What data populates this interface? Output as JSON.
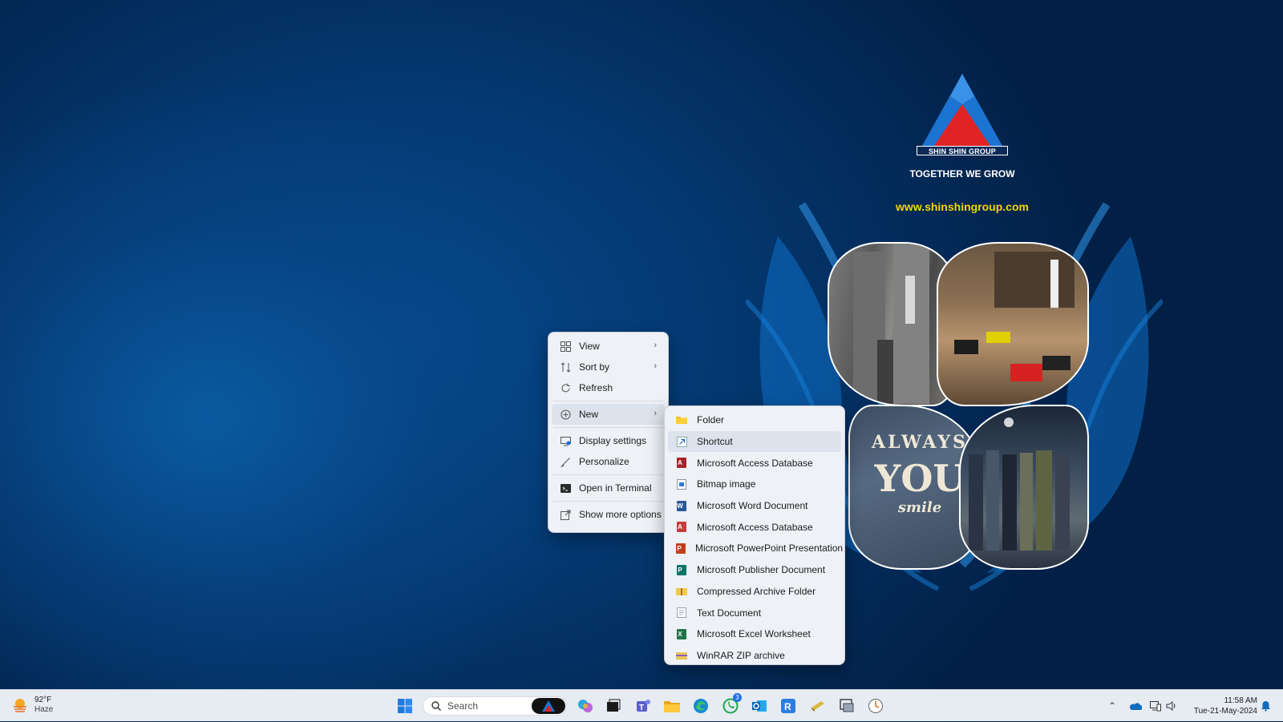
{
  "wallpaper": {
    "brand_name": "SHIN SHIN GROUP",
    "tagline": "TOGETHER WE GROW",
    "website": "www.shinshingroup.com",
    "jacket_text": [
      "ALWAYS",
      "YOU",
      "smile"
    ]
  },
  "context_menu": {
    "items": [
      {
        "label": "View",
        "icon": "view-grid-icon",
        "submenu": true
      },
      {
        "label": "Sort by",
        "icon": "sort-icon",
        "submenu": true
      },
      {
        "label": "Refresh",
        "icon": "refresh-icon",
        "submenu": false
      },
      {
        "label": "New",
        "icon": "new-plus-icon",
        "submenu": true
      },
      {
        "label": "Display settings",
        "icon": "display-icon",
        "submenu": false
      },
      {
        "label": "Personalize",
        "icon": "brush-icon",
        "submenu": false
      },
      {
        "label": "Open in Terminal",
        "icon": "terminal-icon",
        "submenu": false
      },
      {
        "label": "Show more options",
        "icon": "more-options-icon",
        "submenu": false
      }
    ]
  },
  "new_submenu": {
    "items": [
      {
        "label": "Folder",
        "icon": "folder-icon"
      },
      {
        "label": "Shortcut",
        "icon": "shortcut-icon"
      },
      {
        "label": "Microsoft Access Database",
        "icon": "access-icon"
      },
      {
        "label": "Bitmap image",
        "icon": "bitmap-icon"
      },
      {
        "label": "Microsoft Word Document",
        "icon": "word-icon"
      },
      {
        "label": "Microsoft Access Database",
        "icon": "access-icon"
      },
      {
        "label": "Microsoft PowerPoint Presentation",
        "icon": "powerpoint-icon"
      },
      {
        "label": "Microsoft Publisher Document",
        "icon": "publisher-icon"
      },
      {
        "label": "Compressed Archive Folder",
        "icon": "zip-folder-icon"
      },
      {
        "label": "Text Document",
        "icon": "text-document-icon"
      },
      {
        "label": "Microsoft Excel Worksheet",
        "icon": "excel-icon"
      },
      {
        "label": "WinRAR ZIP archive",
        "icon": "winrar-icon"
      }
    ]
  },
  "taskbar": {
    "weather": {
      "temp": "92°F",
      "condition": "Haze"
    },
    "search_placeholder": "Search",
    "whatsapp_badge": "3",
    "clock": {
      "time": "11:58 AM",
      "date": "Tue-21-May-2024"
    }
  }
}
